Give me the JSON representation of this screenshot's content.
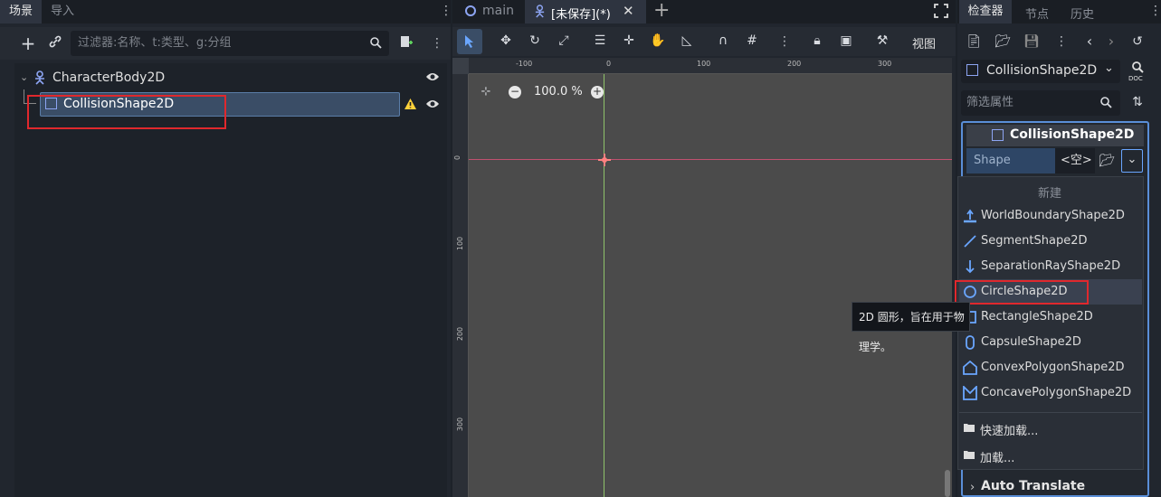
{
  "left_panel": {
    "tabs": [
      "场景",
      "导入"
    ],
    "filter_placeholder": "过滤器:名称、t:类型、g:分组",
    "tree": {
      "root_label": "CharacterBody2D",
      "child_label": "CollisionShape2D"
    }
  },
  "middle_panel": {
    "tabs": [
      "main",
      "[未保存](*)"
    ],
    "toolbar_view_label": "视图",
    "zoom_level": "100.0 %",
    "ruler_h_labels": [
      "-100",
      "0",
      "100",
      "200",
      "300"
    ],
    "ruler_v_labels": [
      "0",
      "100",
      "200",
      "300"
    ]
  },
  "right_panel": {
    "tabs": [
      "检查器",
      "节点",
      "历史"
    ],
    "selected_node": "CollisionShape2D",
    "filter_placeholder": "筛选属性",
    "section_title": "CollisionShape2D",
    "property_name": "Shape",
    "property_value": "<空>",
    "bottom_section": "Auto Translate"
  },
  "dropdown": {
    "header": "新建",
    "items": [
      {
        "label": "WorldBoundaryShape2D",
        "icon": "world-boundary-icon"
      },
      {
        "label": "SegmentShape2D",
        "icon": "segment-icon"
      },
      {
        "label": "SeparationRayShape2D",
        "icon": "separation-ray-icon"
      },
      {
        "label": "CircleShape2D",
        "icon": "circle-icon"
      },
      {
        "label": "RectangleShape2D",
        "icon": "rectangle-icon"
      },
      {
        "label": "CapsuleShape2D",
        "icon": "capsule-icon"
      },
      {
        "label": "ConvexPolygonShape2D",
        "icon": "convex-polygon-icon"
      },
      {
        "label": "ConcavePolygonShape2D",
        "icon": "concave-polygon-icon"
      }
    ],
    "quick_load": "快速加载...",
    "load": "加载..."
  },
  "tooltip": {
    "text": "2D 圆形，旨在用于物理学。"
  },
  "colors": {
    "accent": "#6aa6ff",
    "highlight_red": "#e0282d",
    "warning": "#ffd23a"
  }
}
